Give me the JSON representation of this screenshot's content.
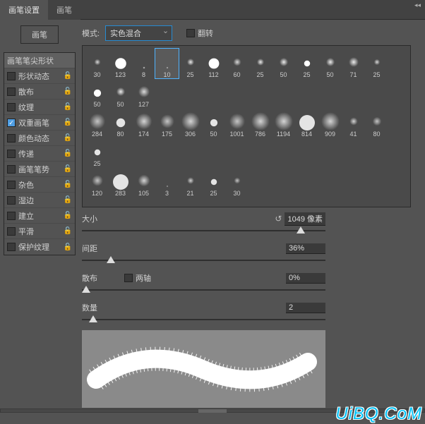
{
  "tabs": [
    {
      "label": "画笔设置",
      "active": true
    },
    {
      "label": "画笔",
      "active": false
    }
  ],
  "brush_button": "画笔",
  "mode_label": "模式:",
  "mode_value": "实色混合",
  "flip_label": "翻转",
  "options_header": "画笔笔尖形状",
  "options": [
    {
      "label": "形状动态",
      "checked": false,
      "lock": true
    },
    {
      "label": "散布",
      "checked": false,
      "lock": true
    },
    {
      "label": "纹理",
      "checked": false,
      "lock": true
    },
    {
      "label": "双重画笔",
      "checked": true,
      "lock": true
    },
    {
      "label": "颜色动态",
      "checked": false,
      "lock": true
    },
    {
      "label": "传递",
      "checked": false,
      "lock": true
    },
    {
      "label": "画笔笔势",
      "checked": false,
      "lock": true
    },
    {
      "label": "杂色",
      "checked": false,
      "lock": true
    },
    {
      "label": "湿边",
      "checked": false,
      "lock": true
    },
    {
      "label": "建立",
      "checked": false,
      "lock": true
    },
    {
      "label": "平滑",
      "checked": false,
      "lock": true
    },
    {
      "label": "保护纹理",
      "checked": false,
      "lock": true
    }
  ],
  "brushes_row1": [
    30,
    123,
    8,
    10,
    25,
    112,
    60,
    25,
    50,
    25,
    50,
    71,
    25,
    50,
    50,
    127
  ],
  "brushes_row2": [
    284,
    80,
    174,
    175,
    306,
    50,
    1001,
    786,
    1194,
    814,
    909,
    41,
    80,
    25
  ],
  "brushes_row3": [
    120,
    283,
    105,
    3,
    21,
    25,
    30
  ],
  "selected_brush_index": 3,
  "size_label": "大小",
  "size_value": "1049 像素",
  "spacing_label": "间距",
  "spacing_value": "36%",
  "scatter_label": "散布",
  "both_axes_label": "两轴",
  "scatter_value": "0%",
  "count_label": "数量",
  "count_value": "2",
  "watermark": "UiBQ.CoM"
}
